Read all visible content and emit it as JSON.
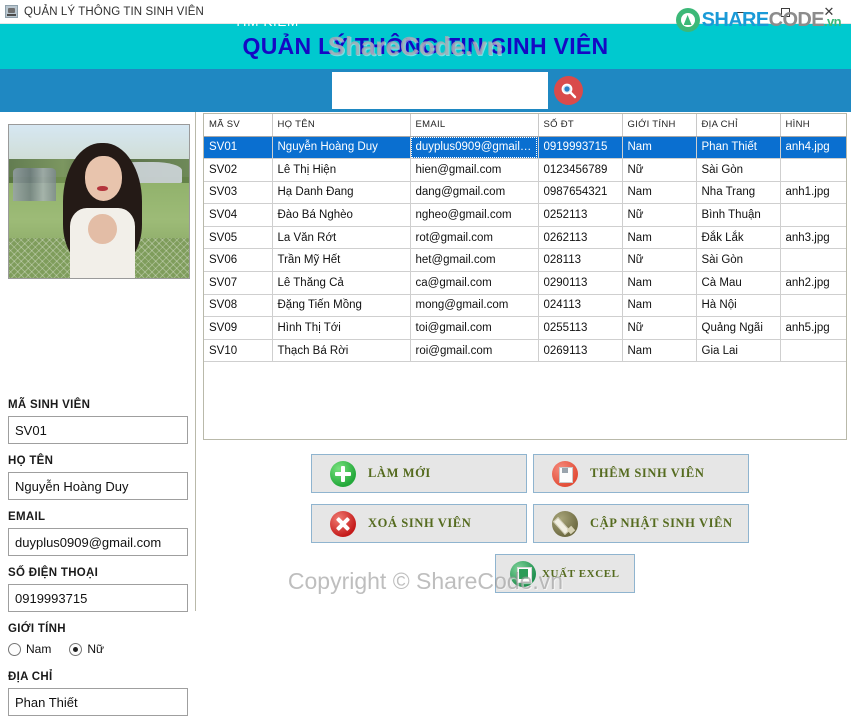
{
  "window": {
    "title": "QUẢN LÝ THÔNG TIN SINH VIÊN",
    "icon": "java-app-icon",
    "minimize_label": "",
    "maximize_label": "",
    "close_label": "✕"
  },
  "brand": {
    "logo_part_a": "SHARE",
    "logo_part_b": "CODE",
    "logo_part_c": ".vn",
    "watermark_header": "ShareCode.vn",
    "watermark_footer": "Copyright © ShareCode.vn",
    "accent_teal": "#00c9cf",
    "accent_blue": "#1f88c2",
    "accent_green": "#3cb878",
    "selection_blue": "#0a6fd0",
    "title_text_color": "#1509c4",
    "button_text_color": "#556b1f"
  },
  "banner": {
    "title": "QUẢN LÝ THÔNG TIN SINH VIÊN"
  },
  "search": {
    "label": "TÌM KIẾM",
    "value": "",
    "placeholder": "",
    "button_icon": "search-icon"
  },
  "form": {
    "photo_alt": "student-photo",
    "fields": [
      {
        "label": "MÃ SINH VIÊN",
        "value": "SV01",
        "name": "student-id"
      },
      {
        "label": "HỌ TÊN",
        "value": "Nguyễn Hoàng Duy",
        "name": "full-name"
      },
      {
        "label": "EMAIL",
        "value": "duyplus0909@gmail.com",
        "name": "email"
      },
      {
        "label": "SỐ ĐIỆN THOẠI",
        "value": "0919993715",
        "name": "phone"
      }
    ],
    "gender": {
      "label": "GIỚI TÍNH",
      "options": [
        {
          "label": "Nam",
          "selected": false
        },
        {
          "label": "Nữ",
          "selected": true
        }
      ]
    },
    "address": {
      "label": "ĐỊA CHỈ",
      "value": "Phan Thiết"
    }
  },
  "table": {
    "columns": [
      "MÃ SV",
      "HỌ TÊN",
      "EMAIL",
      "SỐ ĐT",
      "GIỚI TÍNH",
      "ĐỊA CHỈ",
      "HÌNH"
    ],
    "selected_row_index": 0,
    "rows": [
      [
        "SV01",
        "Nguyễn Hoàng Duy",
        "duyplus0909@gmail.co..",
        "0919993715",
        "Nam",
        "Phan Thiết",
        "anh4.jpg"
      ],
      [
        "SV02",
        "Lê Thị Hiện",
        "hien@gmail.com",
        "0123456789",
        "Nữ",
        "Sài Gòn",
        ""
      ],
      [
        "SV03",
        "Hạ Danh Đang",
        "dang@gmail.com",
        "0987654321",
        "Nam",
        "Nha Trang",
        "anh1.jpg"
      ],
      [
        "SV04",
        "Đào Bá Nghèo",
        "ngheo@gmail.com",
        "0252113",
        "Nữ",
        "Bình Thuận",
        ""
      ],
      [
        "SV05",
        "La Văn Rớt",
        "rot@gmail.com",
        "0262113",
        "Nam",
        "Đắk Lắk",
        "anh3.jpg"
      ],
      [
        "SV06",
        "Trần Mỹ Hết",
        "het@gmail.com",
        "028113",
        "Nữ",
        "Sài Gòn",
        ""
      ],
      [
        "SV07",
        "Lê Thăng Cả",
        "ca@gmail.com",
        "0290113",
        "Nam",
        "Cà Mau",
        "anh2.jpg"
      ],
      [
        "SV08",
        "Đặng Tiến Mồng",
        "mong@gmail.com",
        "024113",
        "Nam",
        "Hà Nội",
        ""
      ],
      [
        "SV09",
        "Hình Thị Tới",
        "toi@gmail.com",
        "0255113",
        "Nữ",
        "Quảng Ngãi",
        "anh5.jpg"
      ],
      [
        "SV10",
        "Thạch Bá Rời",
        "roi@gmail.com",
        "0269113",
        "Nam",
        "Gia Lai",
        ""
      ]
    ]
  },
  "actions": [
    {
      "label": "LÀM MỚI",
      "icon": "plus-circle-icon",
      "name": "new-button"
    },
    {
      "label": "THÊM SINH VIÊN",
      "icon": "save-floppy-icon",
      "name": "add-student-button"
    },
    {
      "label": "XOÁ SINH VIÊN",
      "icon": "delete-x-icon",
      "name": "delete-student-button"
    },
    {
      "label": "CẬP NHẬT SINH VIÊN",
      "icon": "pencil-edit-icon",
      "name": "update-student-button"
    },
    {
      "label": "XUẤT EXCEL",
      "icon": "excel-export-icon",
      "name": "export-excel-button"
    }
  ]
}
